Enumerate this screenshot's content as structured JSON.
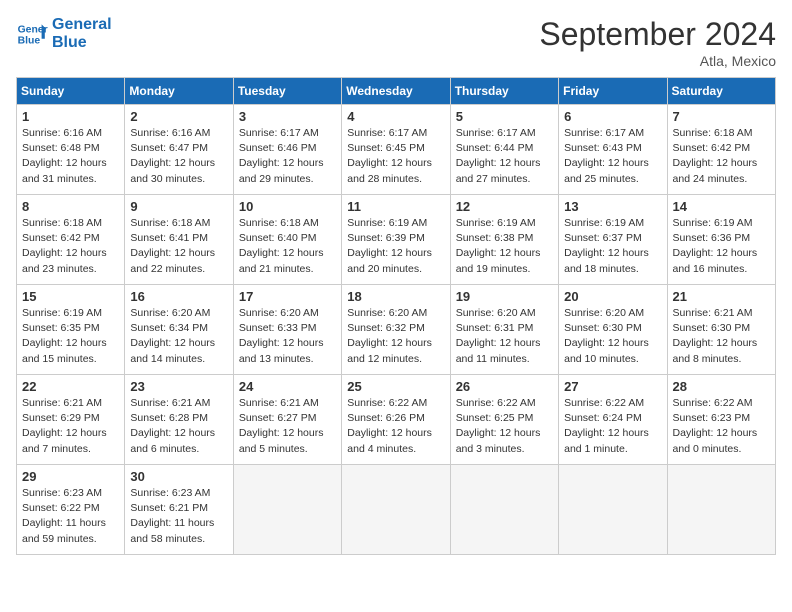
{
  "header": {
    "logo_line1": "General",
    "logo_line2": "Blue",
    "month_title": "September 2024",
    "subtitle": "Atla, Mexico"
  },
  "days_of_week": [
    "Sunday",
    "Monday",
    "Tuesday",
    "Wednesday",
    "Thursday",
    "Friday",
    "Saturday"
  ],
  "weeks": [
    [
      {
        "day": "1",
        "lines": [
          "Sunrise: 6:16 AM",
          "Sunset: 6:48 PM",
          "Daylight: 12 hours",
          "and 31 minutes."
        ]
      },
      {
        "day": "2",
        "lines": [
          "Sunrise: 6:16 AM",
          "Sunset: 6:47 PM",
          "Daylight: 12 hours",
          "and 30 minutes."
        ]
      },
      {
        "day": "3",
        "lines": [
          "Sunrise: 6:17 AM",
          "Sunset: 6:46 PM",
          "Daylight: 12 hours",
          "and 29 minutes."
        ]
      },
      {
        "day": "4",
        "lines": [
          "Sunrise: 6:17 AM",
          "Sunset: 6:45 PM",
          "Daylight: 12 hours",
          "and 28 minutes."
        ]
      },
      {
        "day": "5",
        "lines": [
          "Sunrise: 6:17 AM",
          "Sunset: 6:44 PM",
          "Daylight: 12 hours",
          "and 27 minutes."
        ]
      },
      {
        "day": "6",
        "lines": [
          "Sunrise: 6:17 AM",
          "Sunset: 6:43 PM",
          "Daylight: 12 hours",
          "and 25 minutes."
        ]
      },
      {
        "day": "7",
        "lines": [
          "Sunrise: 6:18 AM",
          "Sunset: 6:42 PM",
          "Daylight: 12 hours",
          "and 24 minutes."
        ]
      }
    ],
    [
      {
        "day": "8",
        "lines": [
          "Sunrise: 6:18 AM",
          "Sunset: 6:42 PM",
          "Daylight: 12 hours",
          "and 23 minutes."
        ]
      },
      {
        "day": "9",
        "lines": [
          "Sunrise: 6:18 AM",
          "Sunset: 6:41 PM",
          "Daylight: 12 hours",
          "and 22 minutes."
        ]
      },
      {
        "day": "10",
        "lines": [
          "Sunrise: 6:18 AM",
          "Sunset: 6:40 PM",
          "Daylight: 12 hours",
          "and 21 minutes."
        ]
      },
      {
        "day": "11",
        "lines": [
          "Sunrise: 6:19 AM",
          "Sunset: 6:39 PM",
          "Daylight: 12 hours",
          "and 20 minutes."
        ]
      },
      {
        "day": "12",
        "lines": [
          "Sunrise: 6:19 AM",
          "Sunset: 6:38 PM",
          "Daylight: 12 hours",
          "and 19 minutes."
        ]
      },
      {
        "day": "13",
        "lines": [
          "Sunrise: 6:19 AM",
          "Sunset: 6:37 PM",
          "Daylight: 12 hours",
          "and 18 minutes."
        ]
      },
      {
        "day": "14",
        "lines": [
          "Sunrise: 6:19 AM",
          "Sunset: 6:36 PM",
          "Daylight: 12 hours",
          "and 16 minutes."
        ]
      }
    ],
    [
      {
        "day": "15",
        "lines": [
          "Sunrise: 6:19 AM",
          "Sunset: 6:35 PM",
          "Daylight: 12 hours",
          "and 15 minutes."
        ]
      },
      {
        "day": "16",
        "lines": [
          "Sunrise: 6:20 AM",
          "Sunset: 6:34 PM",
          "Daylight: 12 hours",
          "and 14 minutes."
        ]
      },
      {
        "day": "17",
        "lines": [
          "Sunrise: 6:20 AM",
          "Sunset: 6:33 PM",
          "Daylight: 12 hours",
          "and 13 minutes."
        ]
      },
      {
        "day": "18",
        "lines": [
          "Sunrise: 6:20 AM",
          "Sunset: 6:32 PM",
          "Daylight: 12 hours",
          "and 12 minutes."
        ]
      },
      {
        "day": "19",
        "lines": [
          "Sunrise: 6:20 AM",
          "Sunset: 6:31 PM",
          "Daylight: 12 hours",
          "and 11 minutes."
        ]
      },
      {
        "day": "20",
        "lines": [
          "Sunrise: 6:20 AM",
          "Sunset: 6:30 PM",
          "Daylight: 12 hours",
          "and 10 minutes."
        ]
      },
      {
        "day": "21",
        "lines": [
          "Sunrise: 6:21 AM",
          "Sunset: 6:30 PM",
          "Daylight: 12 hours",
          "and 8 minutes."
        ]
      }
    ],
    [
      {
        "day": "22",
        "lines": [
          "Sunrise: 6:21 AM",
          "Sunset: 6:29 PM",
          "Daylight: 12 hours",
          "and 7 minutes."
        ]
      },
      {
        "day": "23",
        "lines": [
          "Sunrise: 6:21 AM",
          "Sunset: 6:28 PM",
          "Daylight: 12 hours",
          "and 6 minutes."
        ]
      },
      {
        "day": "24",
        "lines": [
          "Sunrise: 6:21 AM",
          "Sunset: 6:27 PM",
          "Daylight: 12 hours",
          "and 5 minutes."
        ]
      },
      {
        "day": "25",
        "lines": [
          "Sunrise: 6:22 AM",
          "Sunset: 6:26 PM",
          "Daylight: 12 hours",
          "and 4 minutes."
        ]
      },
      {
        "day": "26",
        "lines": [
          "Sunrise: 6:22 AM",
          "Sunset: 6:25 PM",
          "Daylight: 12 hours",
          "and 3 minutes."
        ]
      },
      {
        "day": "27",
        "lines": [
          "Sunrise: 6:22 AM",
          "Sunset: 6:24 PM",
          "Daylight: 12 hours",
          "and 1 minute."
        ]
      },
      {
        "day": "28",
        "lines": [
          "Sunrise: 6:22 AM",
          "Sunset: 6:23 PM",
          "Daylight: 12 hours",
          "and 0 minutes."
        ]
      }
    ],
    [
      {
        "day": "29",
        "lines": [
          "Sunrise: 6:23 AM",
          "Sunset: 6:22 PM",
          "Daylight: 11 hours",
          "and 59 minutes."
        ]
      },
      {
        "day": "30",
        "lines": [
          "Sunrise: 6:23 AM",
          "Sunset: 6:21 PM",
          "Daylight: 11 hours",
          "and 58 minutes."
        ]
      },
      {
        "day": "",
        "lines": []
      },
      {
        "day": "",
        "lines": []
      },
      {
        "day": "",
        "lines": []
      },
      {
        "day": "",
        "lines": []
      },
      {
        "day": "",
        "lines": []
      }
    ]
  ]
}
